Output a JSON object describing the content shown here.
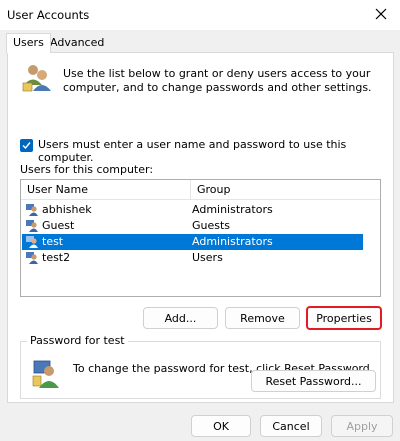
{
  "window": {
    "title": "User Accounts"
  },
  "tabs": [
    {
      "label": "Users"
    },
    {
      "label": "Advanced"
    }
  ],
  "intro": {
    "text": "Use the list below to grant or deny users access to your computer, and to change passwords and other settings."
  },
  "must_login": {
    "label": "Users must enter a user name and password to use this computer.",
    "checked": true
  },
  "users": {
    "label": "Users for this computer:",
    "columns": [
      "User Name",
      "Group"
    ],
    "rows": [
      {
        "name": "abhishek",
        "group": "Administrators"
      },
      {
        "name": "Guest",
        "group": "Guests"
      },
      {
        "name": "test",
        "group": "Administrators"
      },
      {
        "name": "test2",
        "group": "Users"
      }
    ],
    "selected_row": "test"
  },
  "buttons": {
    "add": "Add...",
    "remove": "Remove",
    "properties": "Properties"
  },
  "password_group": {
    "label": "Password for test",
    "text": "To change the password for test, click Reset Password.",
    "reset_button": "Reset Password..."
  },
  "dialog_buttons": {
    "ok": "OK",
    "cancel": "Cancel",
    "apply": "Apply"
  },
  "colors": {
    "selection": "#0078d7",
    "checkbox": "#0067c0",
    "focus_ring": "#e11c24"
  },
  "icons": {
    "users": "users-icon",
    "user": "user-icon",
    "key_user": "user-key-icon",
    "close": "close-icon"
  }
}
